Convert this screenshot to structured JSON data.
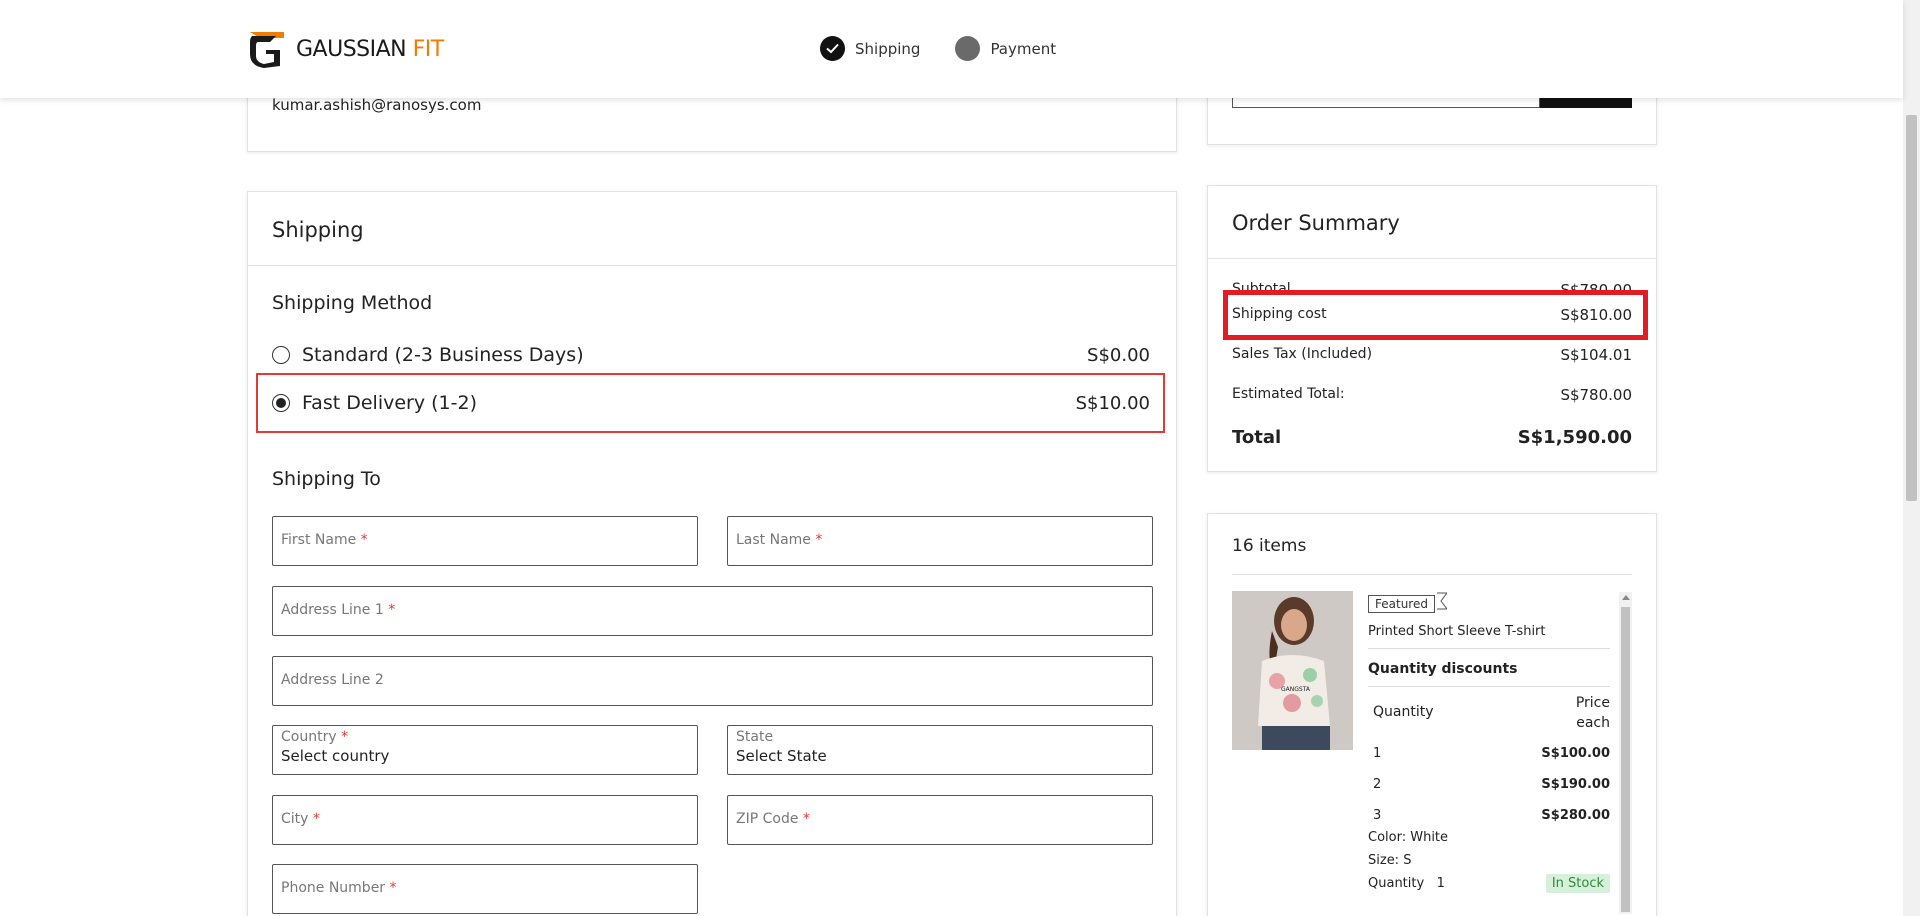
{
  "header": {
    "brand": "GAUSSIAN",
    "brand_accent": "FIT",
    "steps": [
      {
        "label": "Shipping",
        "state": "complete"
      },
      {
        "label": "Payment",
        "state": "pending"
      }
    ]
  },
  "contact": {
    "email": "kumar.ashish@ranosys.com"
  },
  "shipping": {
    "title": "Shipping",
    "method_title": "Shipping Method",
    "methods": [
      {
        "label": "Standard (2-3 Business Days)",
        "price": "S$0.00",
        "selected": false
      },
      {
        "label": "Fast Delivery (1-2)",
        "price": "S$10.00",
        "selected": true
      }
    ],
    "shipping_to_title": "Shipping To",
    "fields": {
      "first_name": "First Name",
      "last_name": "Last Name",
      "address1": "Address Line 1",
      "address2": "Address Line 2",
      "country_label": "Country",
      "country_value": "Select country",
      "state_label": "State",
      "state_value": "Select State",
      "city": "City",
      "zip": "ZIP Code",
      "phone": "Phone Number",
      "required_mark": "*"
    }
  },
  "summary": {
    "title": "Order Summary",
    "rows": [
      {
        "label": "Subtotal",
        "value": "S$780.00"
      },
      {
        "label": "Shipping cost",
        "value": "S$810.00"
      },
      {
        "label": "Sales Tax (Included)",
        "value": "S$104.01"
      },
      {
        "label": "Estimated Total:",
        "value": "S$780.00"
      }
    ],
    "total_label": "Total",
    "total_value": "S$1,590.00"
  },
  "items": {
    "count_label": "16 items",
    "product": {
      "badge": "Featured",
      "name": "Printed Short Sleeve T-shirt",
      "shirt_text": "GANGSTA",
      "discounts_title": "Quantity discounts",
      "col_quantity": "Quantity",
      "col_price_1": "Price",
      "col_price_2": "each",
      "tiers": [
        {
          "qty": "1",
          "price": "S$100.00"
        },
        {
          "qty": "2",
          "price": "S$190.00"
        },
        {
          "qty": "3",
          "price": "S$280.00"
        }
      ],
      "color": "Color: White",
      "size": "Size: S",
      "quantity_label": "Quantity",
      "quantity_value": "1",
      "stock": "In Stock"
    }
  },
  "colors": {
    "accent": "#f07d00",
    "highlight": "#e31b23",
    "in_stock_bg": "#d7f0db"
  }
}
